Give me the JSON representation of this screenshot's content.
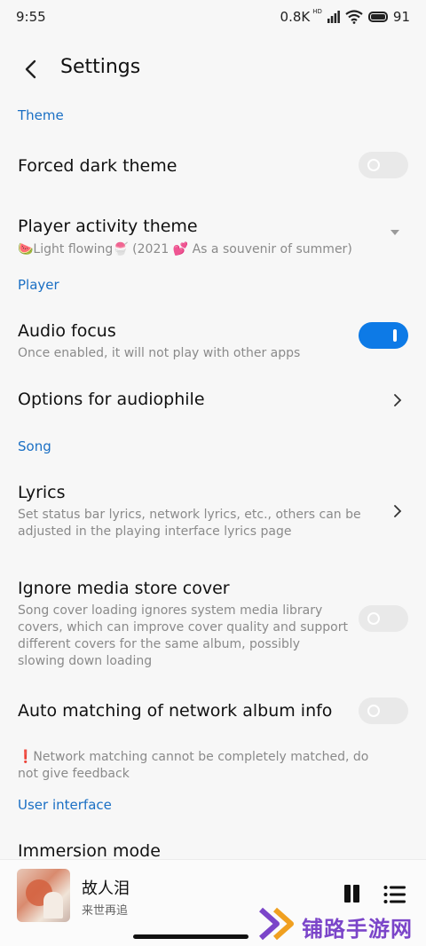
{
  "status": {
    "time": "9:55",
    "net_speed": "0.8K",
    "hd": "HD",
    "battery": "91"
  },
  "header": {
    "title": "Settings"
  },
  "sections": {
    "theme": "Theme",
    "player": "Player",
    "song": "Song",
    "ui": "User interface"
  },
  "settings": {
    "forced_dark": {
      "title": "Forced dark theme",
      "enabled": false
    },
    "player_activity": {
      "title": "Player activity theme",
      "value": "🍉Light flowing🍧 (2021 💕 As a souvenir of summer)"
    },
    "audio_focus": {
      "title": "Audio focus",
      "subtitle": "Once enabled, it will not play with other apps",
      "enabled": true
    },
    "audiophile": {
      "title": "Options for audiophile"
    },
    "lyrics": {
      "title": "Lyrics",
      "subtitle_1": "Set status bar lyrics, network lyrics, etc., others can be",
      "subtitle_2": "adjusted in the playing interface lyrics page"
    },
    "ignore_cover": {
      "title": "Ignore media store cover",
      "subtitle_1": "Song cover loading ignores system media library",
      "subtitle_2": "covers, which can improve cover quality and support",
      "subtitle_3": "different covers for the same album, possibly",
      "subtitle_4": "slowing down loading",
      "enabled": false
    },
    "auto_match": {
      "title": "Auto matching of network album info",
      "enabled": false
    },
    "notice": {
      "line_1": "❗Network matching cannot be completely matched, do",
      "line_2": "not give feedback"
    },
    "immersion": {
      "title": "Immersion mode"
    }
  },
  "player": {
    "song_title": "故人泪",
    "artist": "来世再追"
  },
  "watermark": "铺路手游网",
  "colors": {
    "accent": "#0d7ae6",
    "section_title": "#1a6fc4",
    "watermark": "#7b45c9"
  }
}
